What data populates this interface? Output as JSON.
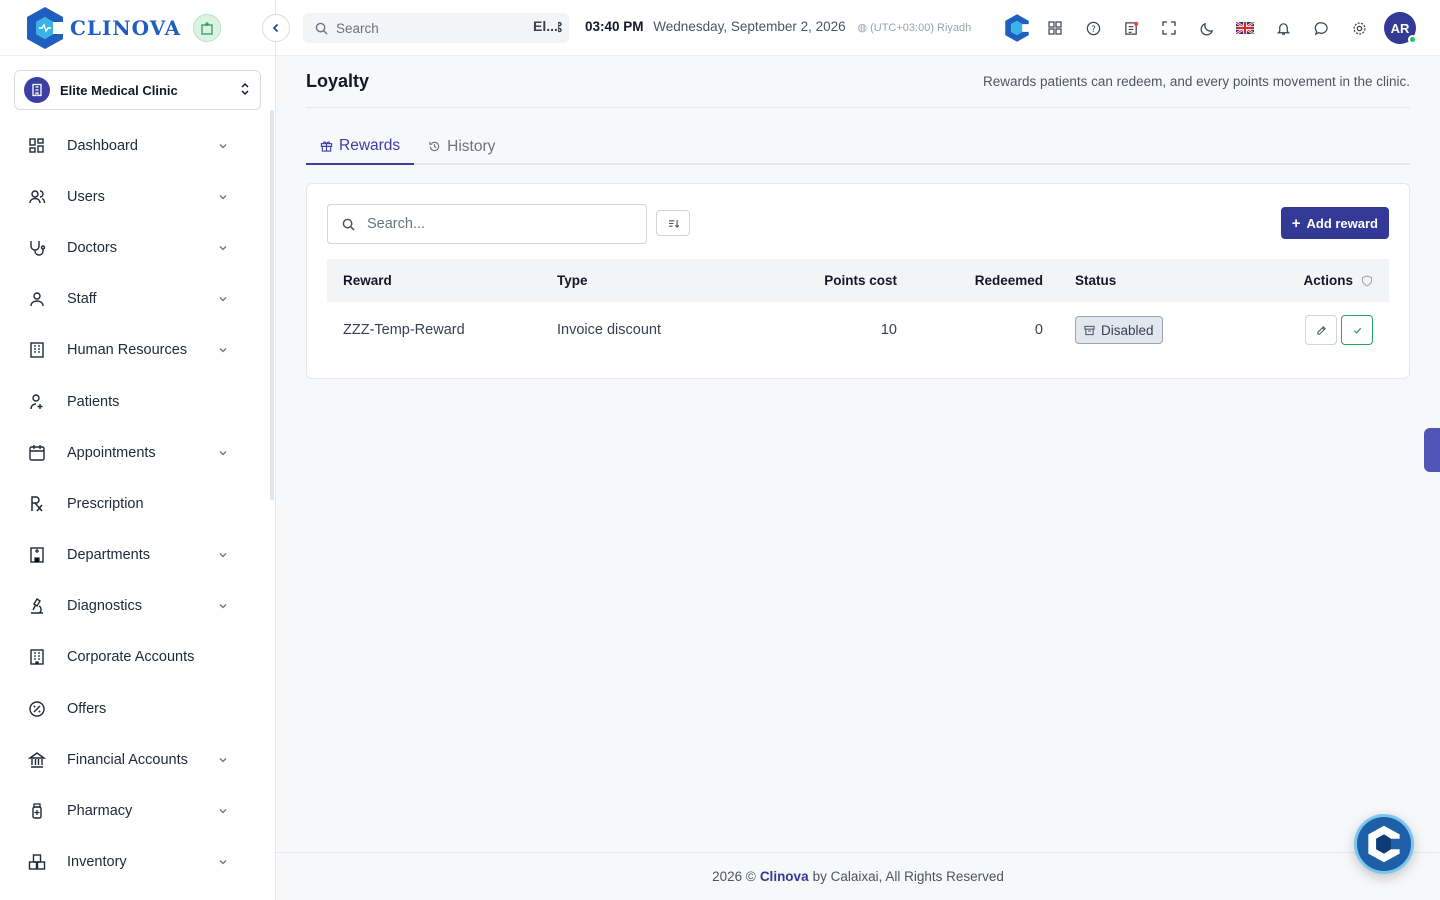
{
  "app": {
    "name": "CLINOVA"
  },
  "clinic": {
    "name": "Elite Medical Clinic"
  },
  "sidebar": {
    "items": [
      {
        "label": "Dashboard",
        "icon": "dashboard-icon",
        "expandable": true
      },
      {
        "label": "Users",
        "icon": "users-icon",
        "expandable": true
      },
      {
        "label": "Doctors",
        "icon": "stethoscope-icon",
        "expandable": true
      },
      {
        "label": "Staff",
        "icon": "staff-icon",
        "expandable": true
      },
      {
        "label": "Human Resources",
        "icon": "building-icon",
        "expandable": true
      },
      {
        "label": "Patients",
        "icon": "patient-icon",
        "expandable": false
      },
      {
        "label": "Appointments",
        "icon": "calendar-icon",
        "expandable": true
      },
      {
        "label": "Prescription",
        "icon": "rx-icon",
        "expandable": false
      },
      {
        "label": "Departments",
        "icon": "department-icon",
        "expandable": true
      },
      {
        "label": "Diagnostics",
        "icon": "microscope-icon",
        "expandable": true
      },
      {
        "label": "Corporate Accounts",
        "icon": "corporate-icon",
        "expandable": false
      },
      {
        "label": "Offers",
        "icon": "offer-icon",
        "expandable": false
      },
      {
        "label": "Financial Accounts",
        "icon": "bank-icon",
        "expandable": true
      },
      {
        "label": "Pharmacy",
        "icon": "pharmacy-icon",
        "expandable": true
      },
      {
        "label": "Inventory",
        "icon": "inventory-icon",
        "expandable": true
      }
    ]
  },
  "topbar": {
    "search_placeholder": "Search",
    "shortcut": "⌘",
    "shortcut_suffix": "El...",
    "time": "03:40 PM",
    "date": "Wednesday, September 2, 2026",
    "timezone": "(UTC+03:00) Riyadh",
    "avatar_initials": "AR"
  },
  "page": {
    "title": "Loyalty",
    "description": "Rewards patients can redeem, and every points movement in the clinic.",
    "tabs": [
      {
        "label": "Rewards",
        "active": true
      },
      {
        "label": "History",
        "active": false
      }
    ]
  },
  "rewards": {
    "search_placeholder": "Search...",
    "add_label": "Add reward",
    "columns": [
      "Reward",
      "Type",
      "Points cost",
      "Redeemed",
      "Status",
      "Actions"
    ],
    "rows": [
      {
        "reward": "ZZZ-Temp-Reward",
        "type": "Invoice discount",
        "points_cost": "10",
        "redeemed": "0",
        "status": "Disabled"
      }
    ]
  },
  "footer": {
    "prefix": "2026 ©",
    "brand": "Clinova",
    "suffix": "by Calaixai, All Rights Reserved"
  },
  "colors": {
    "primary": "#323a96",
    "logo": "#1e5fbf",
    "success": "#22a85a"
  }
}
